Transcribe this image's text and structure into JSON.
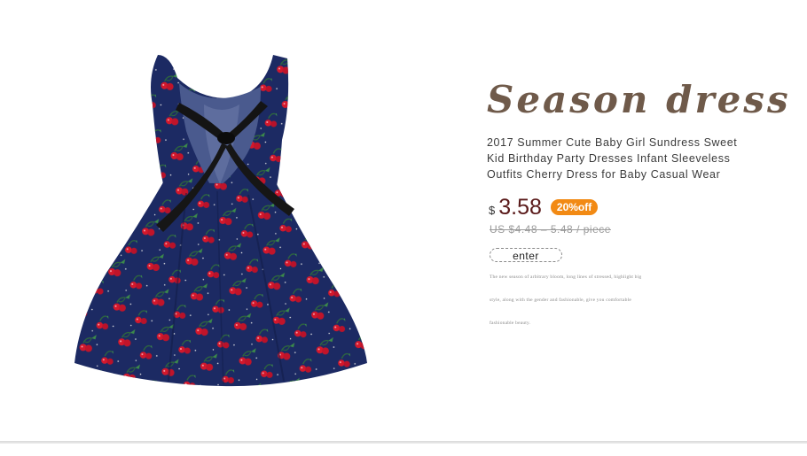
{
  "product": {
    "image_alt": "Navy sleeveless cherry print dress with black bow",
    "headline": "Season dress",
    "description": "2017 Summer Cute Baby Girl Sundress Sweet Kid Birthday Party Dresses Infant Sleeveless Outfits Cherry Dress for Baby Casual Wear",
    "currency_symbol": "$",
    "price": "3.58",
    "discount_badge": "20%off",
    "original_price": "US $4.48 – 5.48 / piece",
    "enter_button": "enter",
    "notes": [
      "The new season of arbitrary bloom, long lines of stressed, highlight big",
      "style, along with the gender and fashionable, give you comfortable",
      "fashionable beauty."
    ]
  },
  "colors": {
    "dress": "#1c2a63",
    "cherry": "#d3182c",
    "bow": "#141414",
    "headline": "#6f5a4a",
    "badge": "#f28a14"
  }
}
